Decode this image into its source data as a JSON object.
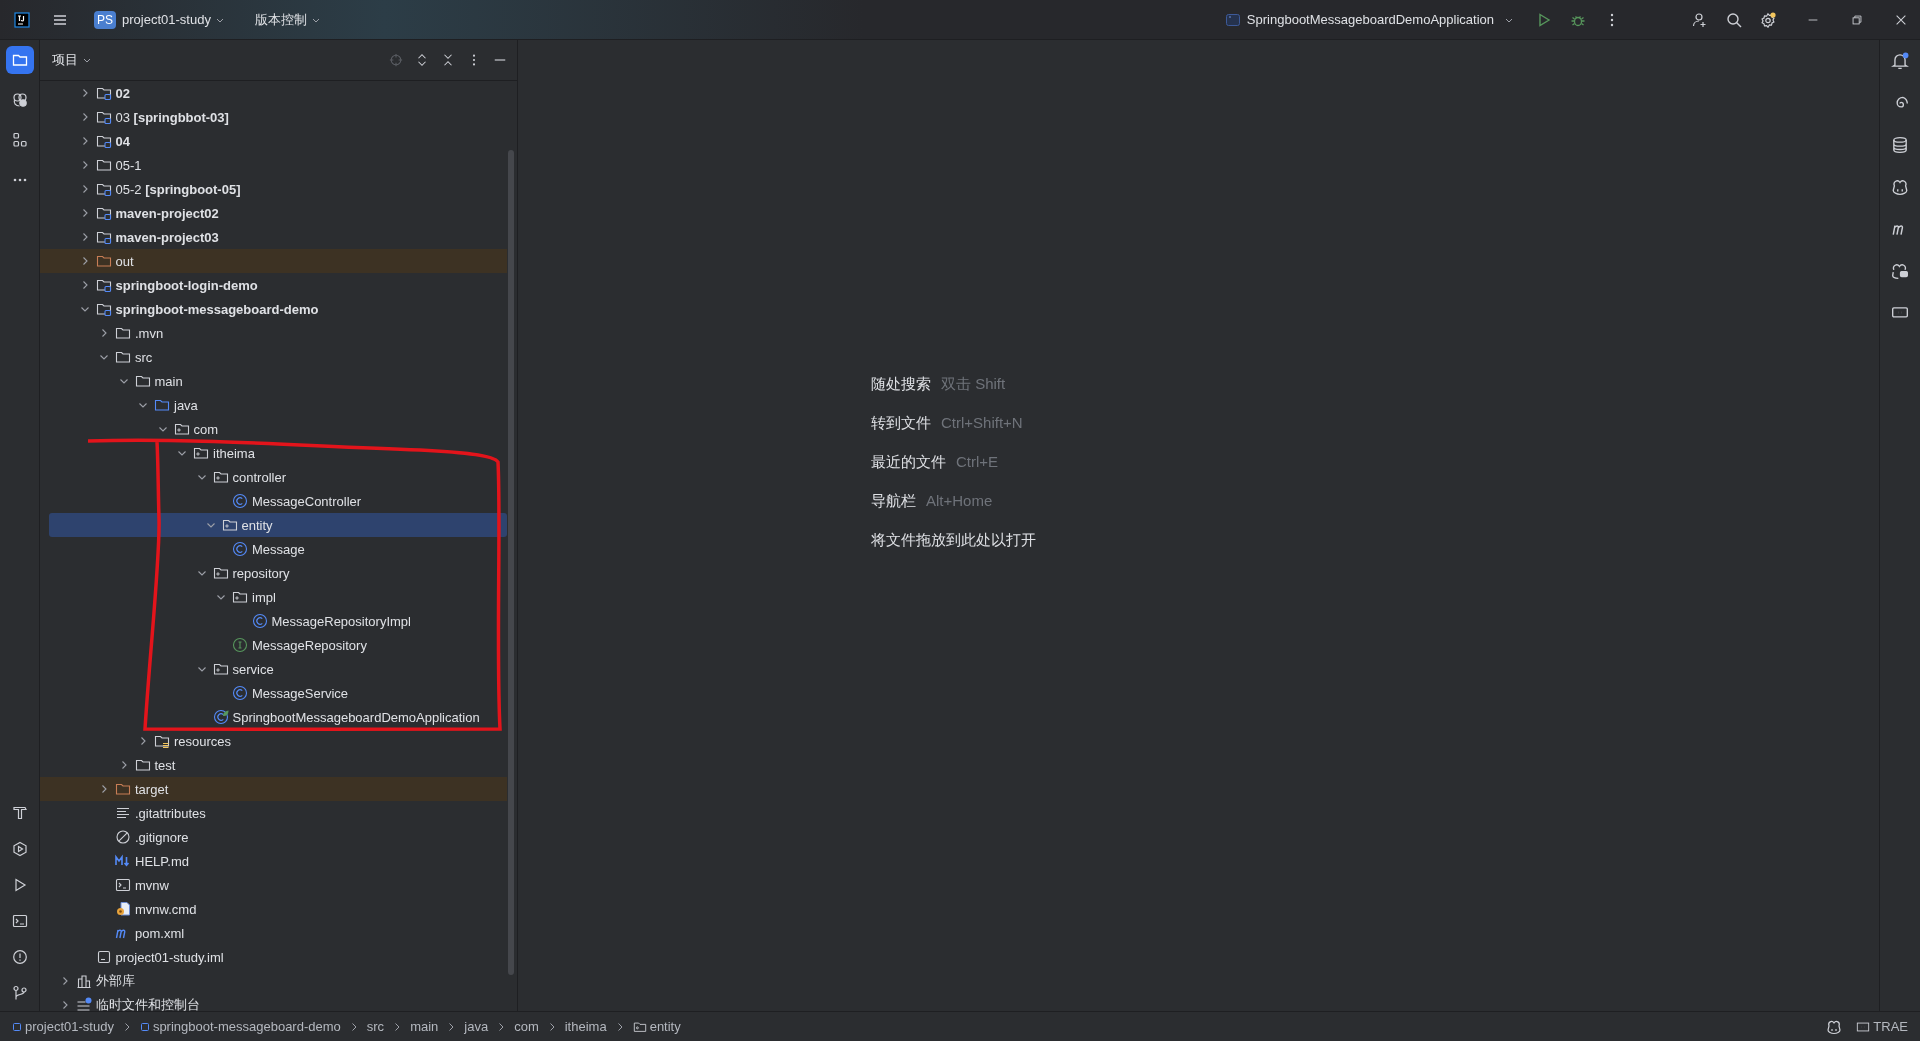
{
  "title_bar": {
    "project_badge": "PS",
    "project": "project01-study",
    "vcs": "版本控制",
    "run_config": "SpringbootMessageboardDemoApplication",
    "settings_badge": true
  },
  "left_toolbar": [
    {
      "kind": "project",
      "selected": true
    },
    {
      "kind": "ai",
      "selected": false
    },
    {
      "kind": "structure",
      "selected": false
    },
    {
      "kind": "more",
      "selected": false
    }
  ],
  "left_toolbar_bottom": [
    {
      "kind": "build"
    },
    {
      "kind": "services"
    },
    {
      "kind": "run"
    },
    {
      "kind": "terminal"
    },
    {
      "kind": "problems"
    },
    {
      "kind": "git"
    }
  ],
  "right_toolbar": [
    {
      "kind": "notifications",
      "badge": true
    },
    {
      "kind": "spiral",
      "badge": false
    },
    {
      "kind": "database",
      "badge": false
    },
    {
      "kind": "copilot",
      "badge": false
    },
    {
      "kind": "maven",
      "badge": false
    },
    {
      "kind": "copilot-chat",
      "badge": false
    },
    {
      "kind": "device",
      "badge": false
    }
  ],
  "project_panel": {
    "title": "项目"
  },
  "project_tree": {
    "items": [
      {
        "label": "02",
        "kind": "module",
        "bold": true,
        "expanded": false,
        "selected": false
      },
      {
        "label": "03 **[springbbot-03]**",
        "kind": "module",
        "bold": false,
        "expanded": false,
        "selected": false
      },
      {
        "label": "04",
        "kind": "module",
        "bold": true,
        "expanded": false,
        "selected": false
      },
      {
        "label": "05-1",
        "kind": "folder",
        "bold": false,
        "expanded": false,
        "selected": false
      },
      {
        "label": "05-2 **[springboot-05]**",
        "kind": "module",
        "bold": false,
        "expanded": false,
        "selected": false
      },
      {
        "label": "maven-project02",
        "kind": "module",
        "bold": true,
        "expanded": false,
        "selected": false
      },
      {
        "label": "maven-project03",
        "kind": "module",
        "bold": true,
        "expanded": false,
        "selected": false
      },
      {
        "label": "out",
        "kind": "excluded",
        "bold": false,
        "expanded": false,
        "selected": false
      },
      {
        "label": "springboot-login-demo",
        "kind": "module",
        "bold": true,
        "expanded": false,
        "selected": false
      },
      {
        "label": "springboot-messageboard-demo",
        "kind": "module",
        "bold": true,
        "expanded": true,
        "selected": false,
        "children": [
          {
            "label": ".mvn",
            "kind": "folder",
            "bold": false,
            "expanded": false,
            "selected": false
          },
          {
            "label": "src",
            "kind": "folder",
            "bold": false,
            "expanded": true,
            "selected": false,
            "children": [
              {
                "label": "main",
                "kind": "folder",
                "bold": false,
                "expanded": true,
                "selected": false,
                "children": [
                  {
                    "label": "java",
                    "kind": "source",
                    "bold": false,
                    "expanded": true,
                    "selected": false,
                    "children": [
                      {
                        "label": "com",
                        "kind": "package",
                        "bold": false,
                        "expanded": true,
                        "selected": false,
                        "children": [
                          {
                            "label": "itheima",
                            "kind": "package",
                            "bold": false,
                            "expanded": true,
                            "selected": false,
                            "children": [
                              {
                                "label": "controller",
                                "kind": "package",
                                "bold": false,
                                "expanded": true,
                                "selected": false,
                                "children": [
                                  {
                                    "label": "MessageController",
                                    "kind": "class",
                                    "bold": false,
                                    "selected": false
                                  }
                                ]
                              },
                              {
                                "label": "entity",
                                "kind": "package",
                                "bold": false,
                                "expanded": true,
                                "selected": true,
                                "children": [
                                  {
                                    "label": "Message",
                                    "kind": "class",
                                    "bold": false,
                                    "selected": false
                                  }
                                ]
                              },
                              {
                                "label": "repository",
                                "kind": "package",
                                "bold": false,
                                "expanded": true,
                                "selected": false,
                                "children": [
                                  {
                                    "label": "impl",
                                    "kind": "package",
                                    "bold": false,
                                    "expanded": true,
                                    "selected": false,
                                    "children": [
                                      {
                                        "label": "MessageRepositoryImpl",
                                        "kind": "class",
                                        "bold": false,
                                        "selected": false
                                      }
                                    ]
                                  },
                                  {
                                    "label": "MessageRepository",
                                    "kind": "interface",
                                    "bold": false,
                                    "selected": false
                                  }
                                ]
                              },
                              {
                                "label": "service",
                                "kind": "package",
                                "bold": false,
                                "expanded": true,
                                "selected": false,
                                "children": [
                                  {
                                    "label": "MessageService",
                                    "kind": "class",
                                    "bold": false,
                                    "selected": false
                                  }
                                ]
                              },
                              {
                                "label": "SpringbootMessageboardDemoApplication",
                                "kind": "springapp",
                                "bold": false,
                                "selected": false
                              }
                            ]
                          }
                        ]
                      }
                    ]
                  },
                  {
                    "label": "resources",
                    "kind": "resources",
                    "bold": false,
                    "expanded": false,
                    "selected": false
                  }
                ]
              },
              {
                "label": "test",
                "kind": "folder",
                "bold": false,
                "expanded": false,
                "selected": false
              }
            ]
          },
          {
            "label": "target",
            "kind": "excluded",
            "bold": false,
            "expanded": false,
            "selected": false
          },
          {
            "label": ".gitattributes",
            "kind": "lines",
            "bold": false,
            "selected": false
          },
          {
            "label": ".gitignore",
            "kind": "gitignore",
            "bold": false,
            "selected": false
          },
          {
            "label": "HELP.md",
            "kind": "markdown",
            "bold": false,
            "selected": false
          },
          {
            "label": "mvnw",
            "kind": "terminal",
            "bold": false,
            "selected": false
          },
          {
            "label": "mvnw.cmd",
            "kind": "cmd",
            "bold": false,
            "selected": false
          },
          {
            "label": "pom.xml",
            "kind": "maven",
            "bold": false,
            "selected": false
          }
        ]
      },
      {
        "label": "project01-study.iml",
        "kind": "iml",
        "bold": false,
        "selected": false
      }
    ],
    "top_level": [
      {
        "label": "外部库",
        "kind": "library",
        "bold": false,
        "expanded": false,
        "selected": false
      },
      {
        "label": "临时文件和控制台",
        "kind": "scratches",
        "bold": false,
        "expanded": false,
        "selected": false
      }
    ]
  },
  "editor_hints": [
    {
      "label": "随处搜索",
      "shortcut": "双击 Shift"
    },
    {
      "label": "转到文件",
      "shortcut": "Ctrl+Shift+N"
    },
    {
      "label": "最近的文件",
      "shortcut": "Ctrl+E"
    },
    {
      "label": "导航栏",
      "shortcut": "Alt+Home"
    },
    {
      "label": "将文件拖放到此处以打开"
    }
  ],
  "breadcrumbs": [
    {
      "label": "project01-study",
      "kind": "module"
    },
    {
      "label": "springboot-messageboard-demo",
      "kind": "module"
    },
    {
      "label": "src",
      "kind": "plain"
    },
    {
      "label": "main",
      "kind": "plain"
    },
    {
      "label": "java",
      "kind": "plain"
    },
    {
      "label": "com",
      "kind": "plain"
    },
    {
      "label": "itheima",
      "kind": "plain"
    },
    {
      "label": "entity",
      "kind": "package"
    }
  ],
  "status_right": {
    "plugin": "TRAE"
  }
}
